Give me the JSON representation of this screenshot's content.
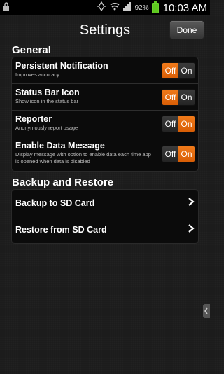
{
  "status_bar": {
    "battery_percent": "92%",
    "time": "10:03 AM",
    "icons": [
      "lock-icon",
      "sync-icon",
      "wifi-icon",
      "signal-icon",
      "battery-icon"
    ]
  },
  "header": {
    "title": "Settings",
    "done_label": "Done"
  },
  "general": {
    "title": "General",
    "items": [
      {
        "title": "Persistent Notification",
        "subtitle": "Improves accuracy",
        "off": "Off",
        "on": "On",
        "state": "off"
      },
      {
        "title": "Status Bar Icon",
        "subtitle": "Show icon in the status bar",
        "off": "Off",
        "on": "On",
        "state": "off"
      },
      {
        "title": "Reporter",
        "subtitle": "Anonymously report usage",
        "off": "Off",
        "on": "On",
        "state": "on"
      },
      {
        "title": "Enable Data Message",
        "subtitle": "Display message with option to enable data each time app is opened when data is disabled",
        "off": "Off",
        "on": "On",
        "state": "on"
      }
    ]
  },
  "backup": {
    "title": "Backup and Restore",
    "items": [
      {
        "title": "Backup to SD Card"
      },
      {
        "title": "Restore from SD Card"
      }
    ]
  },
  "colors": {
    "accent": "#e86c10",
    "background": "#1c1c1c",
    "battery": "#5ec81f"
  }
}
